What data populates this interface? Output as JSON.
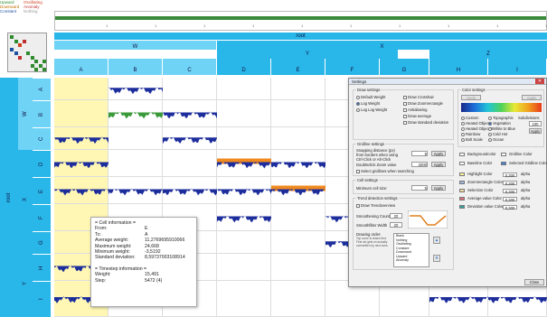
{
  "legend": {
    "items": [
      {
        "label": "Upward",
        "color": "#2e8b2e"
      },
      {
        "label": "Oscillating",
        "color": "#d04020"
      },
      {
        "label": "Downward",
        "color": "#c07000"
      },
      {
        "label": "Anomaly",
        "color": "#c03030"
      },
      {
        "label": "Constant",
        "color": "#2050a0"
      },
      {
        "label": "Nothing",
        "color": "#999999"
      }
    ]
  },
  "timeline": {
    "ticks": [
      "1",
      "1",
      "1",
      "1",
      "1",
      "1",
      "1",
      "1",
      "1",
      "1"
    ]
  },
  "columns": {
    "root": "root",
    "groups": [
      "W",
      "X"
    ],
    "subgroups": [
      "A",
      "B",
      "C",
      "D",
      "E",
      "F",
      "G",
      "H",
      "I"
    ],
    "mid": [
      "Y",
      "Z"
    ]
  },
  "rows": {
    "root": "root",
    "groups": [
      "W",
      "X",
      "Y"
    ],
    "letters": [
      "A",
      "B",
      "C",
      "D",
      "E",
      "F",
      "G",
      "H",
      "I"
    ]
  },
  "tooltip": {
    "cell_header": "= Cell information =",
    "from_label": "From:",
    "from_value": "E",
    "to_label": "To:",
    "to_value": "A",
    "avg_label": "Average weight:",
    "avg_value": "11,2769695910066",
    "max_label": "Maximum weight:",
    "max_value": "24,668",
    "min_label": "Minimum weight:",
    "min_value": "-3,5192",
    "std_label": "Standard deviation:",
    "std_value": "8,59737003108914",
    "ts_header": "= Timestep information =",
    "weight_label": "Weight:",
    "weight_value": "15,491",
    "step_label": "Step:",
    "step_value": "5472 (4)"
  },
  "dialog": {
    "title": "Settings",
    "draw_settings": "Draw settings",
    "default_weight": "Default Weight",
    "log_weight": "Log Weight",
    "log_log_weight": "Log Log Weight",
    "draw_crosshair": "Draw Crosshair",
    "draw_zoomrectangle": "Draw Zoomrectangle",
    "antialiasing": "Antialiasing",
    "draw_average": "Draw average",
    "draw_std": "Draw standard deviation",
    "color_settings": "Color settings",
    "gridline_settings": "Gridline settings",
    "snapping": "Snapping distance (px)",
    "snapping2": "from borders when using",
    "snapping3": "Ctrl-Click or Alt-Click",
    "snapping_value": "5",
    "apply": "Apply",
    "doubleclick": "Doubleclick Zoom value",
    "doubleclick_value": "2000",
    "select_gridlines": "Select gridlines when searching",
    "cell_settings": "Cell settings",
    "min_cell_size": "Minimum cell size:",
    "min_cell_value": "5",
    "trend_settings": "Trend detection settings",
    "draw_trendoverview": "Draw Trendoverview",
    "smoothening_count": "Smoothening Count",
    "smoothening_value": "20",
    "smoothfilter_width": "Smoothfilter Width",
    "smoothfilter_value": "20",
    "drawing_order": "Drawing order:",
    "order_hint": "Top curve is drawn first. First set gets on actually overwritten by next ones.",
    "order_items": [
      "Blank",
      "Nothing",
      "Oscillating",
      "Constant",
      "Downward",
      "Upward",
      "Anomaly"
    ],
    "custom": "Custom",
    "topographic": "Topographic",
    "heated_object": "Heated Object",
    "vegetation": "Vegetation",
    "heated_object2": "Heated Object 2",
    "white_to_blue": "White to Blue",
    "rainbow": "Rainbow",
    "cold_hot": "Cold Hot",
    "bolt_scale": "Bolt Scale",
    "ocean": "Ocean",
    "subdivisions": "Subdivisions",
    "subdivisions_value": "100",
    "background_color": "Backgroundcolor",
    "gridline_color": "Gridline Color",
    "baseline_color": "Baseline Color",
    "selected_gridline_color": "Selected Gridline Color",
    "highlight_color": "Highlight Color",
    "zoomrect_color": "Zoomrectangle Color",
    "selection_color": "Selection Color",
    "avg_value_color": "Average value Color",
    "dev_value_color": "Deviation value Color",
    "alpha_label": "alpha",
    "alpha_value": "0,300",
    "undo": "Undo",
    "apply_colors": "Apply",
    "close": "Close"
  },
  "colors": {
    "accent": "#29b6e8",
    "accent_light": "#6fd3f5",
    "highlight": "#fff7b3",
    "wave_pos": "#3a5fb0",
    "wave_neg": "#1d2e9c",
    "wave_green": "#3a9a3a"
  }
}
